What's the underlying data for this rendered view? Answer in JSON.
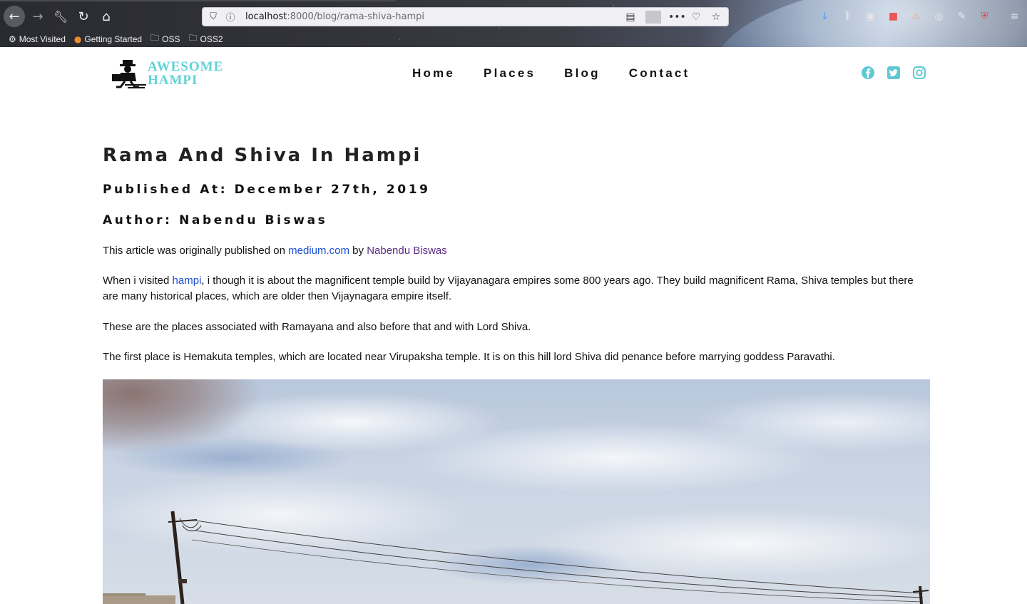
{
  "browser": {
    "url_host": "localhost",
    "url_rest": ":8000/blog/rama-shiva-hampi",
    "bookmarks": [
      {
        "label": "Most Visited",
        "icon": "gear-icon"
      },
      {
        "label": "Getting Started",
        "icon": "firefox-icon"
      },
      {
        "label": "OSS",
        "icon": "folder-icon"
      },
      {
        "label": "OSS2",
        "icon": "folder-icon"
      }
    ]
  },
  "site": {
    "logo_line1": "AWESOME",
    "logo_line2": "HAMPI",
    "brand_color": "#5fd3d6",
    "nav": [
      "Home",
      "Places",
      "Blog",
      "Contact"
    ],
    "social": [
      "facebook-icon",
      "twitter-icon",
      "instagram-icon"
    ]
  },
  "article": {
    "title": "Rama And Shiva In Hampi",
    "published": "Published At: December 27th, 2019",
    "author": "Author: Nabendu Biswas",
    "p1_before": "This article was originally published on ",
    "p1_link1": "medium.com",
    "p1_mid": " by ",
    "p1_link2": "Nabendu Biswas",
    "p2_before": "When i visited ",
    "p2_link": "hampi",
    "p2_after": ", i though it is about the magnificent temple build by Vijayanagara empires some 800 years ago. They build magnificent Rama, Shiva temples but there are many historical places, which are older then Vijaynagara empire itself.",
    "p3": "These are the places associated with Ramayana and also before that and with Lord Shiva.",
    "p4": "The first place is Hemakuta temples, which are located near Virupaksha temple. It is on this hill lord Shiva did penance before marrying goddess Paravathi."
  }
}
